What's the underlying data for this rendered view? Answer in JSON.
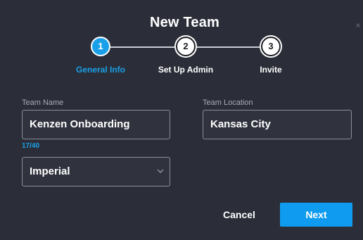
{
  "dialog": {
    "title": "New Team",
    "close_glyph": "×"
  },
  "stepper": {
    "steps": [
      {
        "number": "1",
        "label": "General Info",
        "state": "active"
      },
      {
        "number": "2",
        "label": "Set Up Admin",
        "state": "inactive"
      },
      {
        "number": "3",
        "label": "Invite",
        "state": "inactive"
      }
    ]
  },
  "form": {
    "team_name": {
      "label": "Team Name",
      "value": "Kenzen Onboarding",
      "counter": "17/40"
    },
    "team_location": {
      "label": "Team Location",
      "value": "Kansas City"
    },
    "units": {
      "selected": "Imperial",
      "icon": "chevron-down-icon"
    }
  },
  "actions": {
    "cancel_label": "Cancel",
    "next_label": "Next"
  },
  "colors": {
    "background": "#2b2e38",
    "accent": "#1aa0e8",
    "button_primary": "#0f9cf0",
    "text": "#ffffff",
    "label_muted": "#a7abb5"
  }
}
